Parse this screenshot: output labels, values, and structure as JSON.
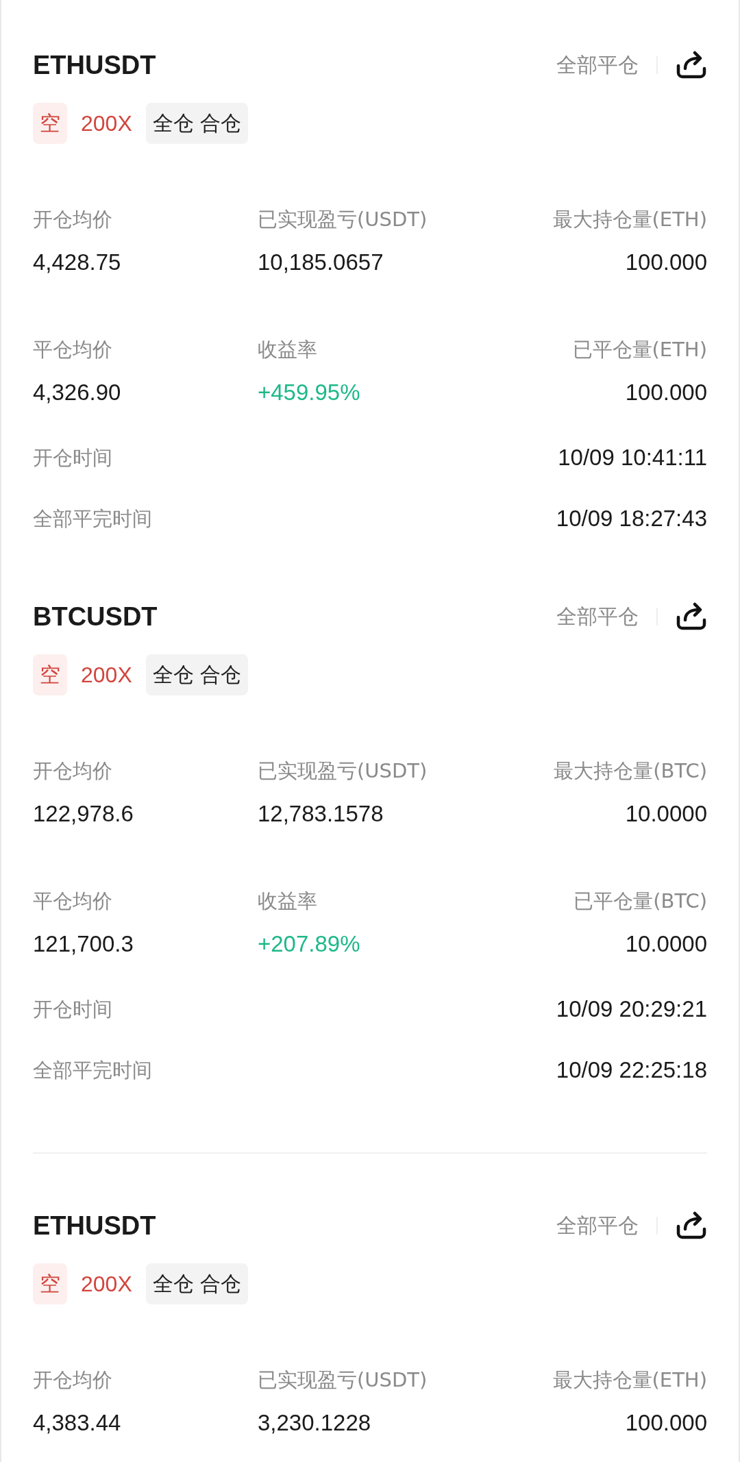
{
  "positions": [
    {
      "symbol": "ETHUSDT",
      "close_all": "全部平仓",
      "side": "空",
      "leverage": "200X",
      "margin_mode": "全仓 合仓",
      "divider_after": false,
      "stats": [
        [
          {
            "label": "开仓均价",
            "value": "4,428.75",
            "positive": false
          },
          {
            "label": "已实现盈亏(USDT)",
            "value": "10,185.0657",
            "positive": false
          },
          {
            "label": "最大持仓量(ETH)",
            "value": "100.000",
            "positive": false
          }
        ],
        [
          {
            "label": "平仓均价",
            "value": "4,326.90",
            "positive": false
          },
          {
            "label": "收益率",
            "value": "+459.95%",
            "positive": true
          },
          {
            "label": "已平仓量(ETH)",
            "value": "100.000",
            "positive": false
          }
        ]
      ],
      "times": [
        {
          "label": "开仓时间",
          "value": "10/09 10:41:11"
        },
        {
          "label": "全部平完时间",
          "value": "10/09 18:27:43"
        }
      ]
    },
    {
      "symbol": "BTCUSDT",
      "close_all": "全部平仓",
      "side": "空",
      "leverage": "200X",
      "margin_mode": "全仓 合仓",
      "divider_after": true,
      "stats": [
        [
          {
            "label": "开仓均价",
            "value": "122,978.6",
            "positive": false
          },
          {
            "label": "已实现盈亏(USDT)",
            "value": "12,783.1578",
            "positive": false
          },
          {
            "label": "最大持仓量(BTC)",
            "value": "10.0000",
            "positive": false
          }
        ],
        [
          {
            "label": "平仓均价",
            "value": "121,700.3",
            "positive": false
          },
          {
            "label": "收益率",
            "value": "+207.89%",
            "positive": true
          },
          {
            "label": "已平仓量(BTC)",
            "value": "10.0000",
            "positive": false
          }
        ]
      ],
      "times": [
        {
          "label": "开仓时间",
          "value": "10/09 20:29:21"
        },
        {
          "label": "全部平完时间",
          "value": "10/09 22:25:18"
        }
      ]
    },
    {
      "symbol": "ETHUSDT",
      "close_all": "全部平仓",
      "side": "空",
      "leverage": "200X",
      "margin_mode": "全仓 合仓",
      "divider_after": false,
      "stats": [
        [
          {
            "label": "开仓均价",
            "value": "4,383.44",
            "positive": false
          },
          {
            "label": "已实现盈亏(USDT)",
            "value": "3,230.1228",
            "positive": false
          },
          {
            "label": "最大持仓量(ETH)",
            "value": "100.000",
            "positive": false
          }
        ]
      ]
    }
  ]
}
